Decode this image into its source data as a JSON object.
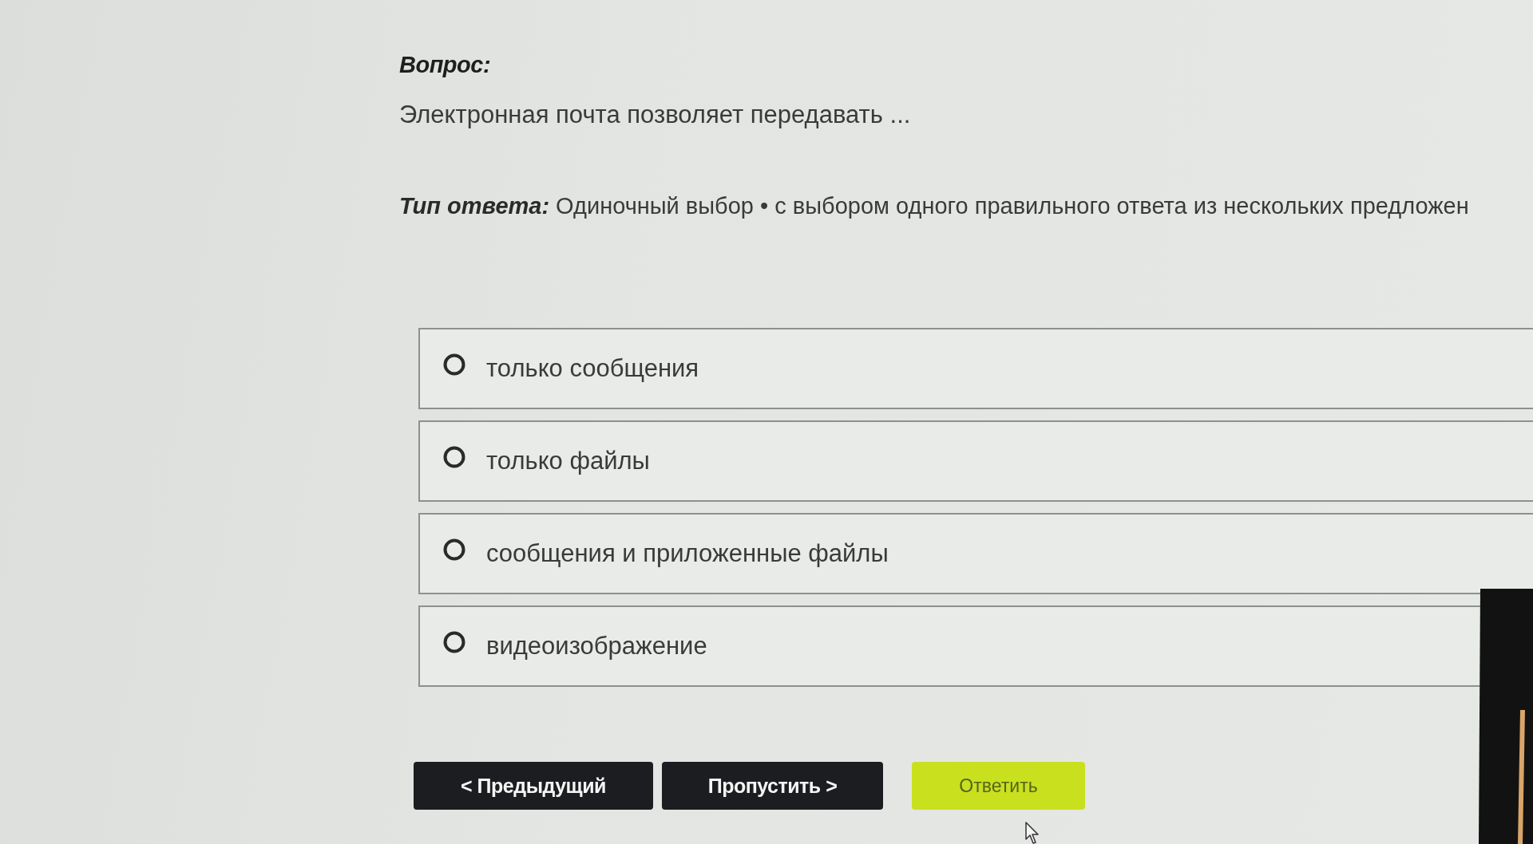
{
  "question": {
    "label": "Вопрос:",
    "text": "Электронная почта позволяет передавать ..."
  },
  "answer_type": {
    "label": "Тип ответа:",
    "text": "Одиночный выбор • с выбором одного правильного ответа из нескольких предложен"
  },
  "options": [
    {
      "label": "только сообщения",
      "selected": false
    },
    {
      "label": "только файлы",
      "selected": false
    },
    {
      "label": "сообщения и приложенные файлы",
      "selected": false
    },
    {
      "label": "видеоизображение",
      "selected": false
    }
  ],
  "buttons": [
    {
      "kind": "back",
      "label": "< Предыдущий"
    },
    {
      "kind": "skip",
      "label": "Пропустить >"
    },
    {
      "kind": "submit",
      "label": "Ответить"
    }
  ]
}
